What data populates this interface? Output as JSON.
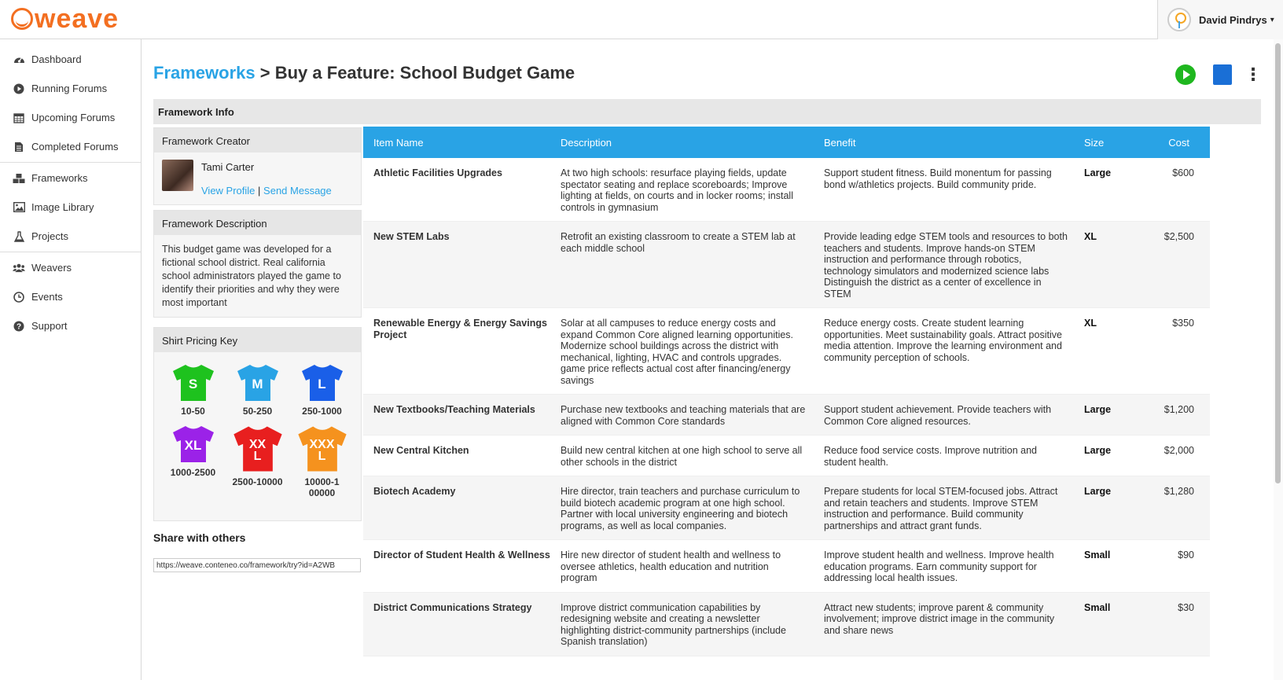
{
  "app": {
    "logo_text": "weave",
    "brand_color": "#f36f21",
    "accent_color": "#29a3e5"
  },
  "user": {
    "name": "David Pindrys",
    "caret": "▾"
  },
  "sidebar": {
    "items": [
      {
        "label": "Dashboard",
        "icon": "dashboard-icon"
      },
      {
        "label": "Running Forums",
        "icon": "play-circle-icon"
      },
      {
        "label": "Upcoming Forums",
        "icon": "calendar-icon"
      },
      {
        "label": "Completed Forums",
        "icon": "document-icon"
      },
      {
        "label": "Frameworks",
        "icon": "cubes-icon"
      },
      {
        "label": "Image Library",
        "icon": "image-icon"
      },
      {
        "label": "Projects",
        "icon": "flask-icon"
      },
      {
        "label": "Weavers",
        "icon": "users-icon"
      },
      {
        "label": "Events",
        "icon": "clock-icon"
      },
      {
        "label": "Support",
        "icon": "help-icon"
      }
    ]
  },
  "header": {
    "breadcrumb_link": "Frameworks",
    "separator": ">",
    "title": "Buy a Feature: School Budget Game"
  },
  "section": {
    "title": "Framework Info"
  },
  "creator": {
    "heading": "Framework Creator",
    "name": "Tami Carter",
    "view_profile": "View Profile",
    "divider": "|",
    "send_message": "Send Message"
  },
  "description": {
    "heading": "Framework Description",
    "text": "This budget game was developed for a fictional school district. Real california school administrators played the game to identify their priorities and why they were most important"
  },
  "pricing_key": {
    "heading": "Shirt Pricing Key",
    "shirts": [
      {
        "size": "S",
        "range": "10-50",
        "color": "#1ec21e"
      },
      {
        "size": "M",
        "range": "50-250",
        "color": "#29a3e5"
      },
      {
        "size": "L",
        "range": "250-1000",
        "color": "#1a5fe8"
      },
      {
        "size": "XL",
        "range": "1000-2500",
        "color": "#9b22e8"
      },
      {
        "size": "XXL",
        "range": "2500-10000",
        "color": "#e81f1f"
      },
      {
        "size": "XXXL",
        "range": "10000-100000",
        "color": "#f5921e"
      }
    ]
  },
  "share": {
    "heading": "Share with others",
    "url": "https://weave.conteneo.co/framework/try?id=A2WB"
  },
  "table": {
    "headers": {
      "name": "Item Name",
      "description": "Description",
      "benefit": "Benefit",
      "size": "Size",
      "cost": "Cost"
    },
    "rows": [
      {
        "name": "Athletic Facilities Upgrades",
        "description": "At two high schools: resurface playing fields, update spectator seating and replace scoreboards; Improve lighting at fields, on courts and in locker rooms; install controls in gymnasium",
        "benefit": "Support student fitness. Build monentum for passing bond w/athletics projects. Build community pride.",
        "size": "Large",
        "cost": "$600"
      },
      {
        "name": "New STEM Labs",
        "description": "Retrofit an existing classroom to create a STEM lab at each middle school",
        "benefit": "Provide leading edge STEM tools and resources to both teachers and students. Improve hands-on STEM instruction and performance through robotics, technology simulators and modernized science labs Distinguish the district as a center of excellence in STEM",
        "size": "XL",
        "cost": "$2,500"
      },
      {
        "name": "Renewable Energy & Energy Savings Project",
        "description": "Solar at all campuses to reduce energy costs and expand Common Core aligned learning opportunities. Modernize school buildings across the district with mechanical, lighting, HVAC and controls upgrades. game price reflects actual cost after financing/energy savings",
        "benefit": "Reduce energy costs. Create student learning opportunities. Meet sustainability goals. Attract positive media attention. Improve the learning environment and community perception of schools.",
        "size": "XL",
        "cost": "$350"
      },
      {
        "name": "New Textbooks/Teaching Materials",
        "description": "Purchase new textbooks and teaching materials that are aligned with Common Core standards",
        "benefit": "Support student achievement. Provide teachers with Common Core aligned resources.",
        "size": "Large",
        "cost": "$1,200"
      },
      {
        "name": "New Central Kitchen",
        "description": "Build new central kitchen at one high school to serve all other schools in the district",
        "benefit": "Reduce food service costs. Improve nutrition and student health.",
        "size": "Large",
        "cost": "$2,000"
      },
      {
        "name": "Biotech Academy",
        "description": "Hire director, train teachers and purchase curriculum to build biotech academic program at one high school. Partner with local university engineering and biotech programs, as well as local companies.",
        "benefit": "Prepare students for local STEM-focused jobs. Attract and retain teachers and students. Improve STEM instruction and performance. Build community partnerships and attract grant funds.",
        "size": "Large",
        "cost": "$1,280"
      },
      {
        "name": "Director of Student Health & Wellness",
        "description": "Hire new director of student health and wellness to oversee athletics, health education and nutrition program",
        "benefit": "Improve student health and wellness. Improve health education programs. Earn community support for addressing local health issues.",
        "size": "Small",
        "cost": "$90"
      },
      {
        "name": "District Communications Strategy",
        "description": "Improve district communication capabilities by redesigning website and creating a newsletter highlighting district-community partnerships (include Spanish translation)",
        "benefit": "Attract new students; improve parent & community involvement; improve district image in the community and share news",
        "size": "Small",
        "cost": "$30"
      }
    ]
  }
}
